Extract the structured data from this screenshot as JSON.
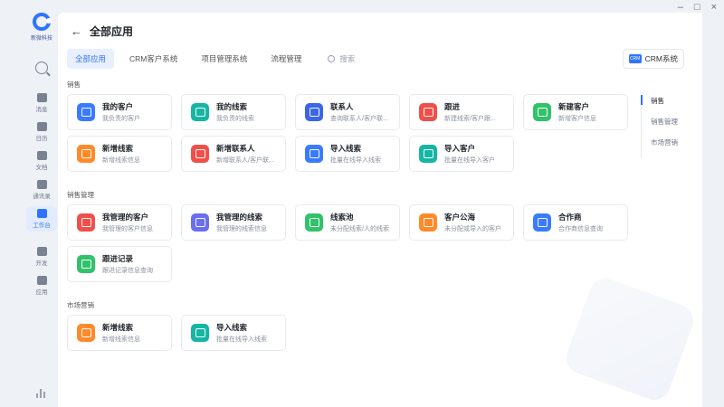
{
  "window": {
    "minimize": "–",
    "maximize": "□",
    "close": "×"
  },
  "brand": {
    "name": "新微科技"
  },
  "rail": {
    "items": [
      {
        "label": "消息",
        "active": false
      },
      {
        "label": "日历",
        "active": false
      },
      {
        "label": "文档",
        "active": false
      },
      {
        "label": "通讯录",
        "active": false
      },
      {
        "label": "工作台",
        "active": true
      },
      {
        "label": "开发",
        "active": false
      },
      {
        "label": "应用",
        "active": false
      }
    ]
  },
  "header": {
    "back": "←",
    "title": "全部应用"
  },
  "tabs": [
    {
      "label": "全部应用",
      "active": true
    },
    {
      "label": "CRM客户系统",
      "active": false
    },
    {
      "label": "项目管理系统",
      "active": false
    },
    {
      "label": "流程管理",
      "active": false
    }
  ],
  "search": {
    "placeholder": "搜索"
  },
  "crm_button": {
    "badge": "CRM",
    "label": "CRM系统"
  },
  "sections": [
    {
      "title": "销售",
      "cards": [
        {
          "name": "我的客户",
          "desc": "我负责的客户",
          "color": "#3b7bff"
        },
        {
          "name": "我的线索",
          "desc": "我负责的线索",
          "color": "#16b5a4"
        },
        {
          "name": "联系人",
          "desc": "查询联系人/客户联...",
          "color": "#3b66e6"
        },
        {
          "name": "跟进",
          "desc": "新建线索/客户跟...",
          "color": "#f0504a"
        },
        {
          "name": "新建客户",
          "desc": "新增客户信息",
          "color": "#32c26b"
        },
        {
          "name": "新增线索",
          "desc": "新增线索信息",
          "color": "#ff8a2a"
        },
        {
          "name": "新增联系人",
          "desc": "新增联系人/客户联...",
          "color": "#f0504a"
        },
        {
          "name": "导入线索",
          "desc": "批量在线导入线索",
          "color": "#3b7bff"
        },
        {
          "name": "导入客户",
          "desc": "批量在线导入客户",
          "color": "#16b5a4"
        }
      ]
    },
    {
      "title": "销售管理",
      "cards": [
        {
          "name": "我管理的客户",
          "desc": "我管理的客户信息",
          "color": "#f0504a"
        },
        {
          "name": "我管理的线索",
          "desc": "我管理的线索信息",
          "color": "#6a6ef0"
        },
        {
          "name": "线索池",
          "desc": "未分配线索/人的线索",
          "color": "#32c26b"
        },
        {
          "name": "客户公海",
          "desc": "未分配或导入的客户",
          "color": "#ff8a2a"
        },
        {
          "name": "合作商",
          "desc": "合作商信息查询",
          "color": "#3b7bff"
        },
        {
          "name": "跟进记录",
          "desc": "跟进记录信息查询",
          "color": "#32c26b"
        }
      ]
    },
    {
      "title": "市场营销",
      "cards": [
        {
          "name": "新增线索",
          "desc": "新增线索信息",
          "color": "#ff8a2a"
        },
        {
          "name": "导入线索",
          "desc": "批量在线导入线索",
          "color": "#16b5a4"
        }
      ]
    }
  ],
  "right_nav": [
    {
      "label": "销售",
      "active": true
    },
    {
      "label": "销售管理",
      "active": false
    },
    {
      "label": "市场营销",
      "active": false
    }
  ]
}
